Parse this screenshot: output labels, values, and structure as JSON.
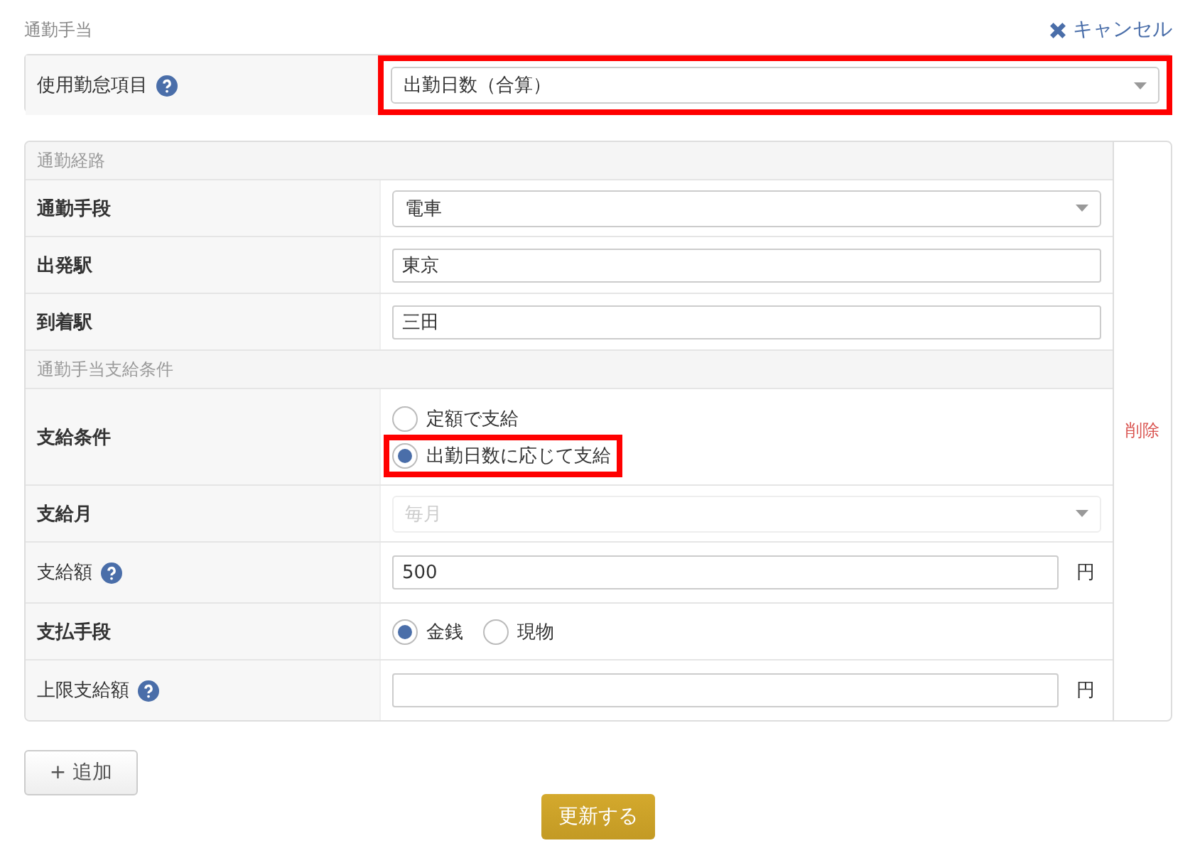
{
  "section_title": "通勤手当",
  "cancel_link": "キャンセル",
  "attendance_item": {
    "label": "使用勤怠項目",
    "help": true,
    "value": "出勤日数（合算）",
    "highlighted": true
  },
  "route_table": {
    "delete_link": "削除",
    "rows": [
      {
        "kind": "section",
        "label": "通勤経路"
      },
      {
        "kind": "select",
        "label": "通勤手段",
        "bold": true,
        "help": false,
        "value": "電車",
        "disabled": false
      },
      {
        "kind": "text",
        "label": "出発駅",
        "bold": true,
        "help": false,
        "value": "東京"
      },
      {
        "kind": "text",
        "label": "到着駅",
        "bold": true,
        "help": false,
        "value": "三田"
      },
      {
        "kind": "section",
        "label": "通勤手当支給条件"
      },
      {
        "kind": "radio_list",
        "label": "支給条件",
        "bold": true,
        "help": false,
        "options": [
          {
            "label": "定額で支給",
            "selected": false,
            "highlighted": false
          },
          {
            "label": "出勤日数に応じて支給",
            "selected": true,
            "highlighted": true
          }
        ]
      },
      {
        "kind": "select",
        "label": "支給月",
        "bold": true,
        "help": false,
        "value": "毎月",
        "disabled": true
      },
      {
        "kind": "text",
        "label": "支給額",
        "bold": false,
        "help": true,
        "value": "500",
        "unit": "円"
      },
      {
        "kind": "radio_inline",
        "label": "支払手段",
        "bold": true,
        "help": false,
        "options": [
          {
            "label": "金銭",
            "selected": true,
            "highlighted": false
          },
          {
            "label": "現物",
            "selected": false,
            "highlighted": false
          }
        ]
      },
      {
        "kind": "text",
        "label": "上限支給額",
        "bold": false,
        "help": true,
        "value": "",
        "unit": "円"
      }
    ]
  },
  "add_button": "+ 追加",
  "submit_button": "更新する"
}
